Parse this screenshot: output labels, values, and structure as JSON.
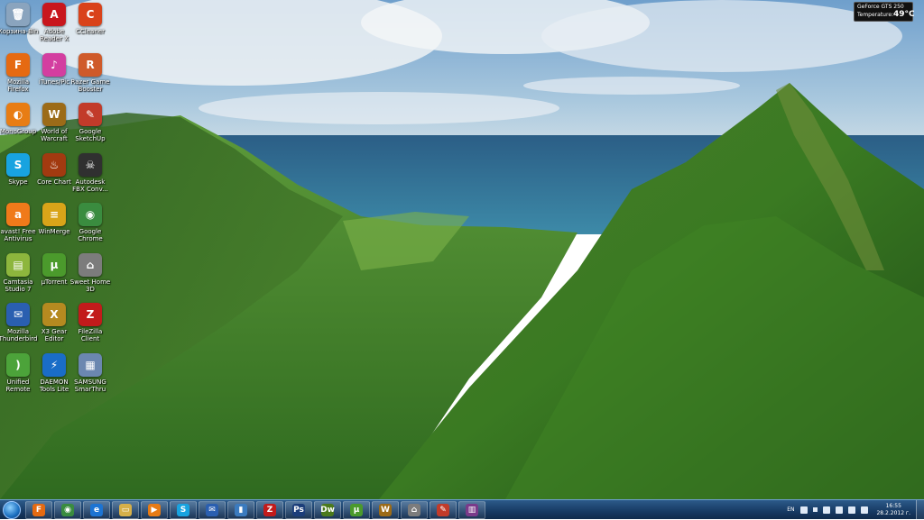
{
  "desktop_icons": [
    {
      "label": "Корзина-Bin",
      "glyph": "🗑",
      "color": "#8aa4be"
    },
    {
      "label": "Adobe Reader X",
      "glyph": "A",
      "color": "#c8161d"
    },
    {
      "label": "CCleaner",
      "glyph": "C",
      "color": "#d9421a"
    },
    {
      "label": "Mozilla Firefox",
      "glyph": "F",
      "color": "#e56a12"
    },
    {
      "label": "iTunes/Pic",
      "glyph": "♪",
      "color": "#d33ea0"
    },
    {
      "label": "Razer Game Booster",
      "glyph": "R",
      "color": "#cf5a2a"
    },
    {
      "label": "MonoGroup",
      "glyph": "◐",
      "color": "#e87d14"
    },
    {
      "label": "World of Warcraft",
      "glyph": "W",
      "color": "#9c6b18"
    },
    {
      "label": "Google SketchUp",
      "glyph": "✎",
      "color": "#c23b2a"
    },
    {
      "label": "Skype",
      "glyph": "S",
      "color": "#18a3e0"
    },
    {
      "label": "Core Chart",
      "glyph": "♨",
      "color": "#a23a10"
    },
    {
      "label": "Autodesk FBX Conv...",
      "glyph": "☠",
      "color": "#303030"
    },
    {
      "label": "avast! Free Antivirus",
      "glyph": "a",
      "color": "#f07a1a"
    },
    {
      "label": "WinMerge",
      "glyph": "≡",
      "color": "#d9a419"
    },
    {
      "label": "Google Chrome",
      "glyph": "◉",
      "color": "#3a8c3f"
    },
    {
      "label": "Camtasia Studio 7",
      "glyph": "▤",
      "color": "#8db63d"
    },
    {
      "label": "µTorrent",
      "glyph": "µ",
      "color": "#4b9a2c"
    },
    {
      "label": "Sweet Home 3D",
      "glyph": "⌂",
      "color": "#7c7c7c"
    },
    {
      "label": "Mozilla Thunderbird",
      "glyph": "✉",
      "color": "#2a5fb0"
    },
    {
      "label": "X3 Gear Editor",
      "glyph": "X",
      "color": "#b58a20"
    },
    {
      "label": "FileZilla Client",
      "glyph": "Z",
      "color": "#c21b1b"
    },
    {
      "label": "Unified Remote",
      "glyph": ")",
      "color": "#4ca33a"
    },
    {
      "label": "DAEMON Tools Lite",
      "glyph": "⚡",
      "color": "#1a6dc7"
    },
    {
      "label": "SAMSUNG SmarThru",
      "glyph": "▦",
      "color": "#6b87b0"
    }
  ],
  "gadget": {
    "name": "GeForce GTS 250",
    "temp_label": "Temperature:",
    "temp_value": "49°C"
  },
  "taskbar": {
    "items": [
      {
        "name": "firefox",
        "glyph": "F",
        "color": "#e56a12"
      },
      {
        "name": "chrome",
        "glyph": "◉",
        "color": "#3a8c3f"
      },
      {
        "name": "internet-explorer",
        "glyph": "e",
        "color": "#1c74d3"
      },
      {
        "name": "explorer",
        "glyph": "▭",
        "color": "#d6b04a"
      },
      {
        "name": "media-player",
        "glyph": "▶",
        "color": "#e77b15"
      },
      {
        "name": "skype",
        "glyph": "S",
        "color": "#18a3e0"
      },
      {
        "name": "thunderbird",
        "glyph": "✉",
        "color": "#2a5fb0"
      },
      {
        "name": "book",
        "glyph": "▮",
        "color": "#3b7bbf"
      },
      {
        "name": "filezilla",
        "glyph": "Z",
        "color": "#c21b1b"
      },
      {
        "name": "photoshop",
        "glyph": "Ps",
        "color": "#1c3e7a"
      },
      {
        "name": "dreamweaver",
        "glyph": "Dw",
        "color": "#4c7a1c"
      },
      {
        "name": "utorrent",
        "glyph": "µ",
        "color": "#4b9a2c"
      },
      {
        "name": "warcraft",
        "glyph": "W",
        "color": "#9c6b18"
      },
      {
        "name": "sweethome",
        "glyph": "⌂",
        "color": "#7c7c7c"
      },
      {
        "name": "sketchup",
        "glyph": "✎",
        "color": "#c23b2a"
      },
      {
        "name": "winrar",
        "glyph": "▥",
        "color": "#7a3a8a"
      }
    ],
    "tray": {
      "lang": "EN",
      "time": "16:55",
      "date": "28.2.2012 г."
    }
  }
}
